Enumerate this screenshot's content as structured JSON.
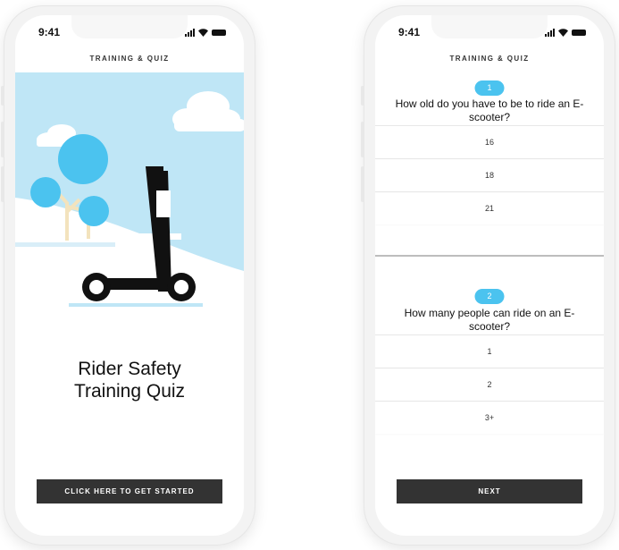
{
  "left_screen": {
    "time": "9:41",
    "nav_title": "TRAINING & QUIZ",
    "title_line1": "Rider Safety",
    "title_line2": "Training Quiz",
    "cta_label": "CLICK HERE TO GET STARTED"
  },
  "right_screen": {
    "time": "9:41",
    "nav_title": "TRAINING & QUIZ",
    "questions": [
      {
        "number": "1",
        "text": "How old do you have to be to ride an E-scooter?",
        "answers": [
          "16",
          "18",
          "21"
        ]
      },
      {
        "number": "2",
        "text": "How many people can ride on an E-scooter?",
        "answers": [
          "1",
          "2",
          "3+"
        ]
      }
    ],
    "next_label": "NEXT"
  },
  "colors": {
    "accent": "#4bc3ef",
    "sky": "#bfe6f6",
    "button": "#333333",
    "scooter": "#111111"
  }
}
